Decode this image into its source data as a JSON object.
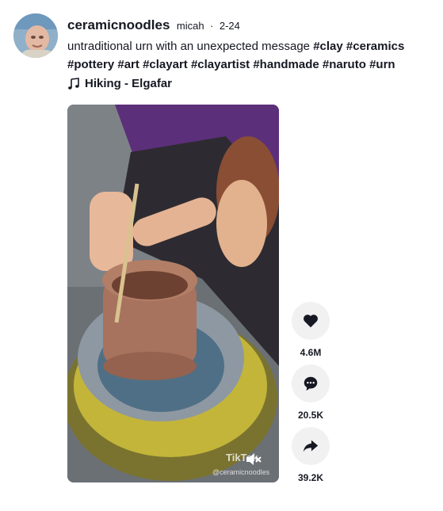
{
  "post": {
    "username": "ceramicnoodles",
    "nickname": "micah",
    "separator": "·",
    "date": "2-24",
    "caption_text": "untraditional urn with an unexpected message",
    "hashtags": [
      "#clay",
      "#ceramics",
      "#pottery",
      "#art",
      "#clayart",
      "#clayartist",
      "#handmade",
      "#naruto",
      "#urn"
    ],
    "music": "Hiking - Elgafar"
  },
  "video": {
    "watermark_brand": "TikTok",
    "watermark_handle": "@ceramicnoodles"
  },
  "actions": {
    "likes": "4.6M",
    "comments": "20.5K",
    "shares": "39.2K"
  },
  "colors": {
    "text": "#161823",
    "action_bg": "#f1f1f2"
  },
  "icons": {
    "music": "music-note-icon",
    "like": "heart-icon",
    "comment": "comment-icon",
    "share": "share-icon",
    "mute": "mute-icon"
  }
}
